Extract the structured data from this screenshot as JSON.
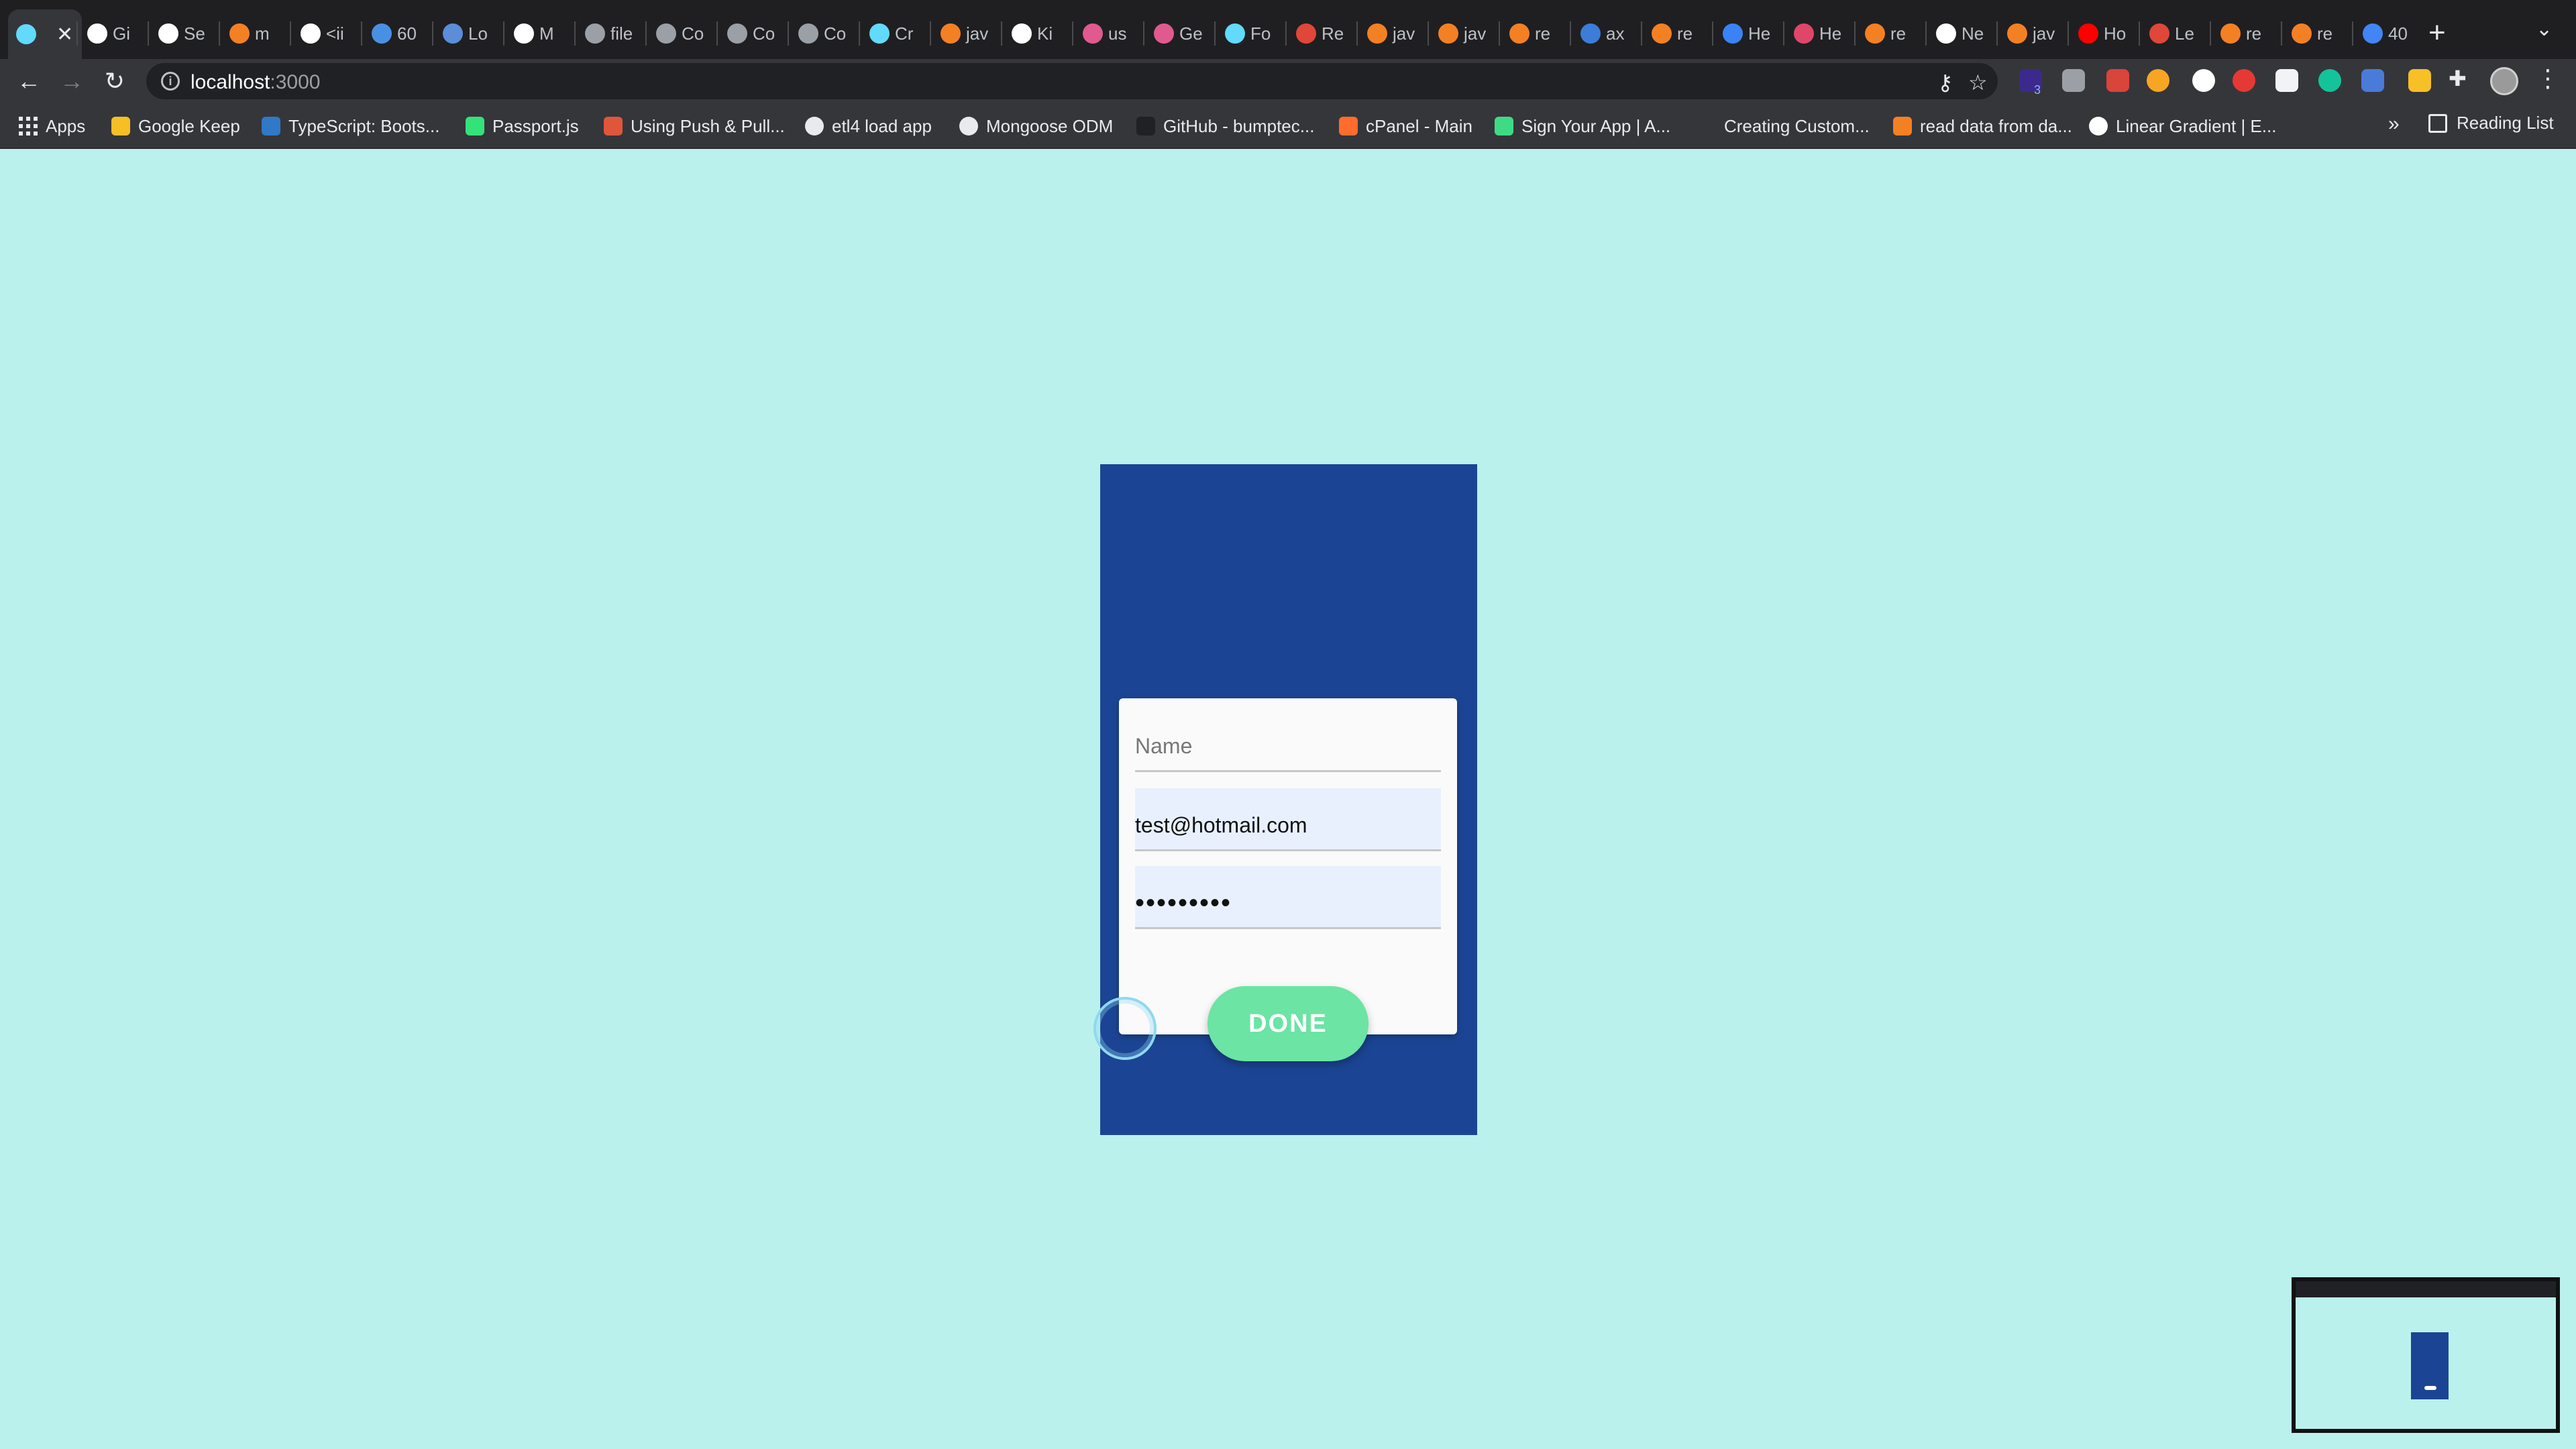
{
  "browser": {
    "tabs": [
      {
        "label": "",
        "icon": "react-icon",
        "color": "#61dafb"
      },
      {
        "label": "Gi",
        "icon": "github-icon",
        "color": "#ffffff"
      },
      {
        "label": "Se",
        "icon": "github-icon",
        "color": "#ffffff"
      },
      {
        "label": "m",
        "icon": "stackoverflow-icon",
        "color": "#f48024"
      },
      {
        "label": "<ii",
        "icon": "bird-icon",
        "color": "#ffffff"
      },
      {
        "label": "60",
        "icon": "f-icon",
        "color": "#4a90e2"
      },
      {
        "label": "Lo",
        "icon": "w3schools-icon",
        "color": "#5b8dd9"
      },
      {
        "label": "M",
        "icon": "codepen-icon",
        "color": "#ffffff"
      },
      {
        "label": "file",
        "icon": "globe-icon",
        "color": "#9aa0a6"
      },
      {
        "label": "Co",
        "icon": "globe-icon",
        "color": "#9aa0a6"
      },
      {
        "label": "Co",
        "icon": "globe-icon",
        "color": "#9aa0a6"
      },
      {
        "label": "Co",
        "icon": "globe-icon",
        "color": "#9aa0a6"
      },
      {
        "label": "Cr",
        "icon": "react-icon",
        "color": "#61dafb"
      },
      {
        "label": "jav",
        "icon": "stackoverflow-icon",
        "color": "#f48024"
      },
      {
        "label": "Ki",
        "icon": "codepen-icon",
        "color": "#ffffff"
      },
      {
        "label": "us",
        "icon": "square-icon",
        "color": "#e05a8f"
      },
      {
        "label": "Ge",
        "icon": "square-icon",
        "color": "#e05a8f"
      },
      {
        "label": "Fo",
        "icon": "react-icon",
        "color": "#61dafb"
      },
      {
        "label": "Re",
        "icon": "arrow-icon",
        "color": "#e0463a"
      },
      {
        "label": "jav",
        "icon": "stackoverflow-icon",
        "color": "#f48024"
      },
      {
        "label": "jav",
        "icon": "stackoverflow-icon",
        "color": "#f48024"
      },
      {
        "label": "re",
        "icon": "stackoverflow-icon",
        "color": "#f48024"
      },
      {
        "label": "ax",
        "icon": "leaf-icon",
        "color": "#3b7dd8"
      },
      {
        "label": "re",
        "icon": "stackoverflow-icon",
        "color": "#f48024"
      },
      {
        "label": "He",
        "icon": "ring-icon",
        "color": "#3b82f6"
      },
      {
        "label": "He",
        "icon": "record-icon",
        "color": "#e0466a"
      },
      {
        "label": "re",
        "icon": "stackoverflow-icon",
        "color": "#f48024"
      },
      {
        "label": "Ne",
        "icon": "github-icon",
        "color": "#ffffff"
      },
      {
        "label": "jav",
        "icon": "stackoverflow-icon",
        "color": "#f48024"
      },
      {
        "label": "Ho",
        "icon": "youtube-icon",
        "color": "#ff0000"
      },
      {
        "label": "Le",
        "icon": "c-icon",
        "color": "#e0463a"
      },
      {
        "label": "re",
        "icon": "stackoverflow-icon",
        "color": "#f48024"
      },
      {
        "label": "re",
        "icon": "stackoverflow-icon",
        "color": "#f48024"
      },
      {
        "label": "40",
        "icon": "google-icon",
        "color": "#4285f4"
      }
    ],
    "url_host": "localhost",
    "url_port": ":3000",
    "bookmarks": [
      {
        "label": "Apps",
        "icon": "apps-grid-icon",
        "color": "#e8eaed"
      },
      {
        "label": "Google Keep",
        "icon": "keep-icon",
        "color": "#f6bf26"
      },
      {
        "label": "TypeScript: Boots...",
        "icon": "typescript-icon",
        "color": "#3178c6"
      },
      {
        "label": "Passport.js",
        "icon": "passport-icon",
        "color": "#34e27a"
      },
      {
        "label": "Using Push & Pull...",
        "icon": "bookmark-icon",
        "color": "#e0563a"
      },
      {
        "label": "etl4 load app",
        "icon": "globe-icon",
        "color": "#e8eaed"
      },
      {
        "label": "Mongoose ODM",
        "icon": "globe-icon",
        "color": "#e8eaed"
      },
      {
        "label": "GitHub - bumptec...",
        "icon": "github-icon",
        "color": "#202124"
      },
      {
        "label": "cPanel - Main",
        "icon": "cpanel-icon",
        "color": "#ff6c2c"
      },
      {
        "label": "Sign Your App | A...",
        "icon": "android-icon",
        "color": "#3ddc84"
      },
      {
        "label": "Creating Custom...",
        "icon": "bookmark-icon",
        "color": "#35363a"
      },
      {
        "label": "read data from da...",
        "icon": "stackoverflow-icon",
        "color": "#f48024"
      },
      {
        "label": "Linear Gradient | E...",
        "icon": "google-icon",
        "color": "#ffffff"
      }
    ],
    "more_bookmarks": "»",
    "reading_list": "Reading List",
    "extension_badge": "3"
  },
  "form": {
    "name_placeholder": "Name",
    "email_value": "test@hotmail.com",
    "password_value": "•••••••••",
    "done_label": "DONE"
  },
  "colors": {
    "page_bg": "#bbf1ec",
    "phone_bg": "#1b4594",
    "button_bg": "#6be4a4",
    "autofill_bg": "#e8f0fe"
  }
}
